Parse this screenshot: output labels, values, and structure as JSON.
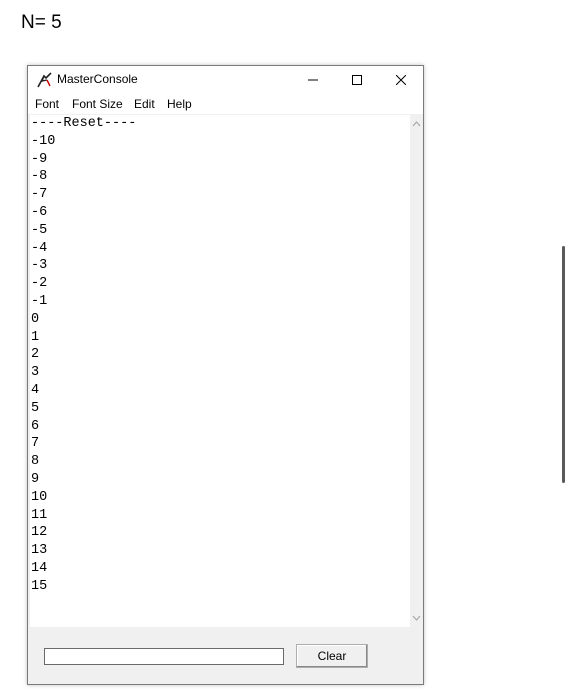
{
  "page": {
    "label": "N= 5"
  },
  "window": {
    "title": "MasterConsole",
    "controls": {
      "minimize": "minimize-icon",
      "maximize": "maximize-icon",
      "close": "close-icon"
    }
  },
  "menu": [
    "Font",
    "Font Size",
    "Edit",
    "Help"
  ],
  "console": {
    "lines": [
      "----Reset----",
      "-10",
      "-9",
      "-8",
      "-7",
      "-6",
      "-5",
      "-4",
      "-3",
      "-2",
      "-1",
      "0",
      "1",
      "2",
      "3",
      "4",
      "5",
      "6",
      "7",
      "8",
      "9",
      "10",
      "11",
      "12",
      "13",
      "14",
      "15"
    ]
  },
  "input": {
    "value": ""
  },
  "clear_label": "Clear"
}
